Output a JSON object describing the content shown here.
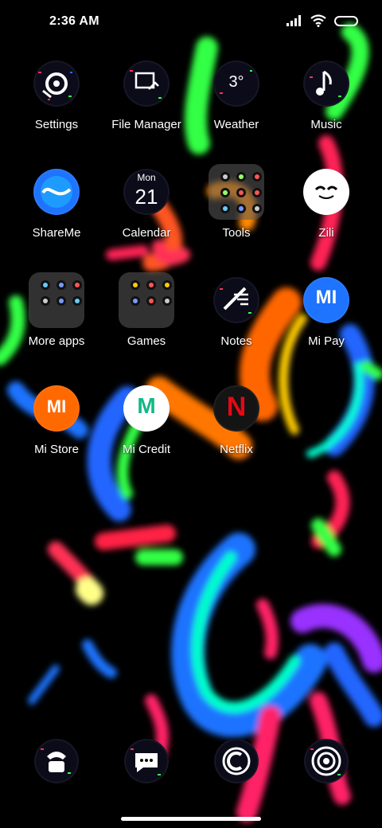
{
  "status": {
    "time": "2:36 AM"
  },
  "apps": [
    {
      "label": "Settings",
      "glyph": "settings-gear"
    },
    {
      "label": "File Manager",
      "glyph": "folder-doc"
    },
    {
      "label": "Weather",
      "text": "3°"
    },
    {
      "label": "Music",
      "glyph": "note"
    },
    {
      "label": "ShareMe",
      "glyph": "wave"
    },
    {
      "label": "Calendar",
      "day": "Mon",
      "date": "21"
    },
    {
      "label": "Tools",
      "folder": true
    },
    {
      "label": "Zili",
      "glyph": "face"
    },
    {
      "label": "More apps",
      "folder": true
    },
    {
      "label": "Games",
      "folder": true
    },
    {
      "label": "Notes",
      "glyph": "pen"
    },
    {
      "label": "Mi Pay",
      "text": "MI"
    },
    {
      "label": "Mi Store",
      "text": "MI"
    },
    {
      "label": "Mi Credit",
      "text": "M"
    },
    {
      "label": "Netflix",
      "text": "N"
    }
  ],
  "dock": [
    {
      "name": "phone"
    },
    {
      "name": "messages"
    },
    {
      "name": "browser"
    },
    {
      "name": "camera"
    }
  ],
  "colors": {
    "accent_blue": "#1e73ff",
    "accent_orange": "#ff6a00",
    "netflix_red": "#e50914",
    "mi_orange": "#ff6900"
  }
}
